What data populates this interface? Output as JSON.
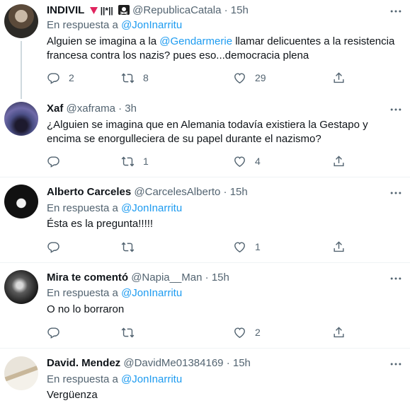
{
  "tweets": [
    {
      "name": "INDIVIL",
      "name_suffix": "||*||",
      "handle": "@RepublicaCatala",
      "time": "15h",
      "reply_prefix": "En respuesta a",
      "reply_to": "@JonInarritu",
      "text_before": "Alguien se imagina a la ",
      "mention": "@Gendarmerie",
      "text_after": " llamar delicuentes a la resistencia francesa contra los nazis? pues eso...democracia plena",
      "replies": "2",
      "retweets": "8",
      "likes": "29"
    },
    {
      "name": "Xaf",
      "handle": "@xaframa",
      "time": "3h",
      "text": "¿Alguien se imagina que en Alemania todavía  existiera la Gestapo y encima se enorgulleciera de su papel durante  el nazismo?",
      "replies": "",
      "retweets": "1",
      "likes": "4"
    },
    {
      "name": "Alberto Carceles",
      "handle": "@CarcelesAlberto",
      "time": "15h",
      "reply_prefix": "En respuesta a",
      "reply_to": "@JonInarritu",
      "text": "Ésta es la pregunta!!!!!",
      "replies": "",
      "retweets": "",
      "likes": "1"
    },
    {
      "name": "Mira te comentó",
      "handle": "@Napia__Man",
      "time": "15h",
      "reply_prefix": "En respuesta a",
      "reply_to": "@JonInarritu",
      "text": "O no lo borraron",
      "replies": "",
      "retweets": "",
      "likes": "2"
    },
    {
      "name": "David. Mendez",
      "handle": "@DavidMe01384169",
      "time": "15h",
      "reply_prefix": "En respuesta a",
      "reply_to": "@JonInarritu",
      "text": "Vergüenza"
    }
  ],
  "separator": "·",
  "colors": {
    "link": "#1d9bf0",
    "secondary": "#536471",
    "primary": "#0f1419",
    "divider": "#eff3f4",
    "flag_red": "#e0245e"
  },
  "icons": {
    "reply": "reply-icon",
    "retweet": "retweet-icon",
    "like": "heart-icon",
    "share": "share-icon",
    "more": "more-icon"
  }
}
